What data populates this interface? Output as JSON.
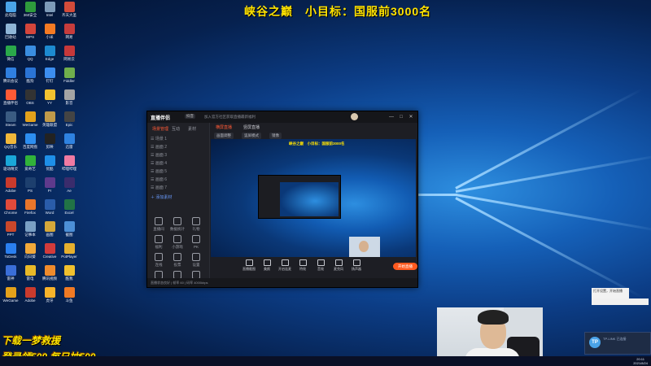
{
  "stream_title": "峡谷之巅　小目标：国服前3000名",
  "promo": {
    "line1": "下载一梦救援",
    "line2": "登录领500 每日抽500"
  },
  "desktop_icons": [
    {
      "label": "此电脑",
      "color": "#4aa3e8"
    },
    {
      "label": "360安全",
      "color": "#2e9a3c"
    },
    {
      "label": "Intel",
      "color": "#7d9ab8"
    },
    {
      "label": "齐天大圣",
      "color": "#d24b3a"
    },
    {
      "label": "回收站",
      "color": "#8fb5d6"
    },
    {
      "label": "WPS",
      "color": "#d4453b"
    },
    {
      "label": "小米",
      "color": "#f57a23"
    },
    {
      "label": "网易",
      "color": "#c63c3c"
    },
    {
      "label": "微信",
      "color": "#2aa84a"
    },
    {
      "label": "QQ",
      "color": "#3a8ee0"
    },
    {
      "label": "Edge",
      "color": "#1d8ad0"
    },
    {
      "label": "网易云",
      "color": "#c6383a"
    },
    {
      "label": "腾讯会议",
      "color": "#2f7fe0"
    },
    {
      "label": "酷狗",
      "color": "#2a74d5"
    },
    {
      "label": "钉钉",
      "color": "#3c8ef0"
    },
    {
      "label": "Fiddler",
      "color": "#6fae4c"
    },
    {
      "label": "直播伴侣",
      "color": "#ff5a36"
    },
    {
      "label": "OBS",
      "color": "#333"
    },
    {
      "label": "YY",
      "color": "#f2c230"
    },
    {
      "label": "影音",
      "color": "#a4a4a4"
    },
    {
      "label": "Steam",
      "color": "#3a5b82"
    },
    {
      "label": "WeGame",
      "color": "#e3a11b"
    },
    {
      "label": "英雄联盟",
      "color": "#c09a4a"
    },
    {
      "label": "Epic",
      "color": "#444"
    },
    {
      "label": "QQ音乐",
      "color": "#f0b73a"
    },
    {
      "label": "百度网盘",
      "color": "#2d8ef0"
    },
    {
      "label": "剪映",
      "color": "#222"
    },
    {
      "label": "迅雷",
      "color": "#2f82e0"
    },
    {
      "label": "驱动精灵",
      "color": "#1aa7d8"
    },
    {
      "label": "爱奇艺",
      "color": "#31b33a"
    },
    {
      "label": "优酷",
      "color": "#1e8fe8"
    },
    {
      "label": "哔哩哔哩",
      "color": "#f07aa2"
    },
    {
      "label": "Adobe",
      "color": "#c93a2d"
    },
    {
      "label": "PS",
      "color": "#1d3f6e"
    },
    {
      "label": "Pr",
      "color": "#5e3a8c"
    },
    {
      "label": "Ae",
      "color": "#3a2c6c"
    },
    {
      "label": "Chrome",
      "color": "#e04a3b"
    },
    {
      "label": "Firefox",
      "color": "#e9762b"
    },
    {
      "label": "Word",
      "color": "#2a5caa"
    },
    {
      "label": "Excel",
      "color": "#217346"
    },
    {
      "label": "PPT",
      "color": "#c9472b"
    },
    {
      "label": "记事本",
      "color": "#7aa0c4"
    },
    {
      "label": "画图",
      "color": "#d4a73a"
    },
    {
      "label": "截图",
      "color": "#4c8fd6"
    },
    {
      "label": "ToDesk",
      "color": "#2a7ff0"
    },
    {
      "label": "向日葵",
      "color": "#f2a93a"
    },
    {
      "label": "Creative",
      "color": "#d23b3b"
    },
    {
      "label": "PotPlayer",
      "color": "#e6b02e"
    },
    {
      "label": "雷神",
      "color": "#3a6ed8"
    },
    {
      "label": "雷电",
      "color": "#e8b928"
    },
    {
      "label": "腾讯视频",
      "color": "#ef8b2c"
    },
    {
      "label": "酷我",
      "color": "#f0c02e"
    },
    {
      "label": "WeGame",
      "color": "#e3a11b"
    },
    {
      "label": "Adobe",
      "color": "#c93a2d"
    },
    {
      "label": "虎牙",
      "color": "#f7b32b"
    },
    {
      "label": "斗鱼",
      "color": "#f07a24"
    }
  ],
  "app": {
    "logo": "直播伴侣",
    "version": "抖音",
    "notice": "加入官方社区获取直播最新福利",
    "window_buttons": [
      "—",
      "□",
      "✕"
    ],
    "sidebar_tabs": [
      "场景管理",
      "互动",
      "素材"
    ],
    "sidebar_rows": [
      "☰ 场景 1",
      "☰ 画面 2",
      "☰ 画面 3",
      "☰ 画面 4",
      "☰ 画面 5",
      "☰ 画面 6",
      "☰ 画面 7",
      "＋ 添加素材"
    ],
    "grid_buttons": [
      "直播间",
      "数据统计",
      "礼物",
      "福利",
      "小游戏",
      "PK",
      "连线",
      "投票",
      "设置",
      "分享",
      "更多",
      "帮助"
    ],
    "main_tabs": [
      "横屏直播",
      "竖屏直播"
    ],
    "tools": [
      "画面调整",
      "竖屏模式",
      "镜像"
    ],
    "preview_title": "峡谷之巅　小目标：国服前3000名",
    "bottom_tools": [
      "直播截图",
      "美颜",
      "开启连麦",
      "特效",
      "音效",
      "麦克风",
      "扬声器"
    ],
    "live_button": "开始直播",
    "status_text": "直播状态良好 | 帧率 60 | 码率 4000kbps"
  },
  "tray": {
    "popup": "打开设置，开始直播",
    "toast_logo": "TP",
    "toast_text": "TP-LINK 已连接"
  },
  "clock": {
    "time": "20:11",
    "date": "2021/8/24"
  }
}
